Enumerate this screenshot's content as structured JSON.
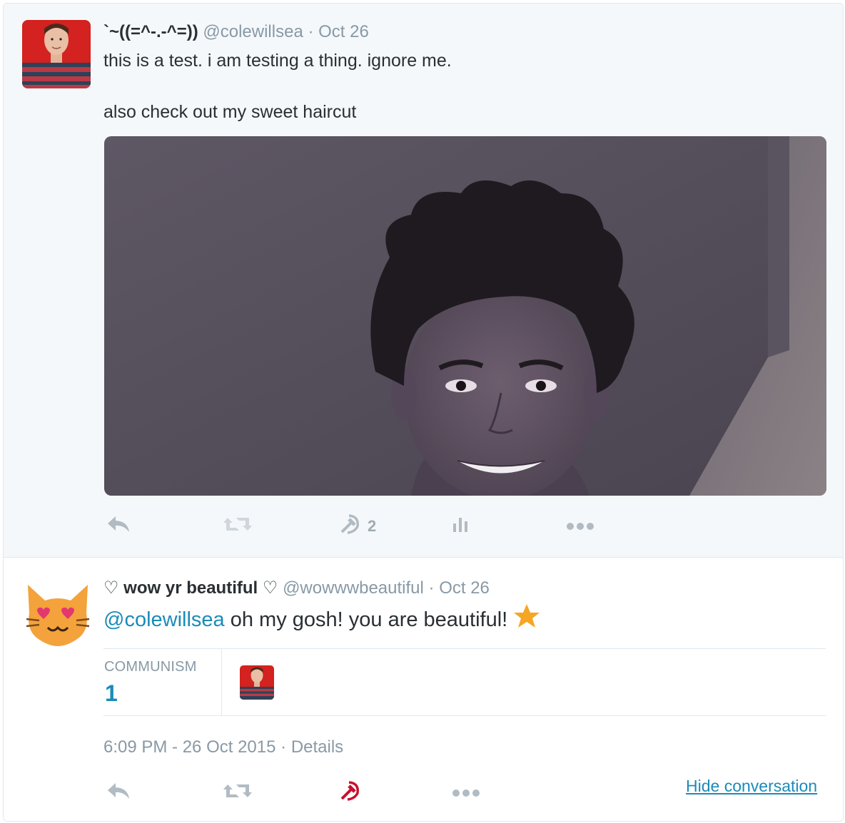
{
  "parent_tweet": {
    "fullname": "`~((=^-.-^=))",
    "screen_name": "@colewillsea",
    "separator": "·",
    "time": "Oct 26",
    "text_line1": "this is a test. i am testing a thing. ignore me.",
    "text_line2": "also check out my sweet haircut",
    "actions": {
      "reply_icon": "reply-icon",
      "retweet_icon": "retweet-icon",
      "like_icon": "hammer-sickle-icon",
      "like_count": "2",
      "analytics_icon": "analytics-icon",
      "more_icon": "more-icon"
    }
  },
  "reply_tweet": {
    "fullname": "♡ wow yr beautiful ♡",
    "screen_name": "@wowwwbeautiful",
    "separator": "·",
    "time": "Oct 26",
    "mention": "@colewillsea",
    "text": " oh my gosh! you are beautiful!",
    "emoji": "star-icon",
    "stats": {
      "label": "COMMUNISM",
      "value": "1"
    },
    "timestamp": "6:09 PM - 26 Oct 2015",
    "separator2": "·",
    "details_label": "Details",
    "hide_conversation_label": "Hide conversation",
    "like_color": "#e0245e"
  },
  "colors": {
    "link": "#1b8bb9",
    "muted": "#8899a6",
    "text": "#292f33",
    "like_active": "#c8102e",
    "star": "#f5a623"
  }
}
